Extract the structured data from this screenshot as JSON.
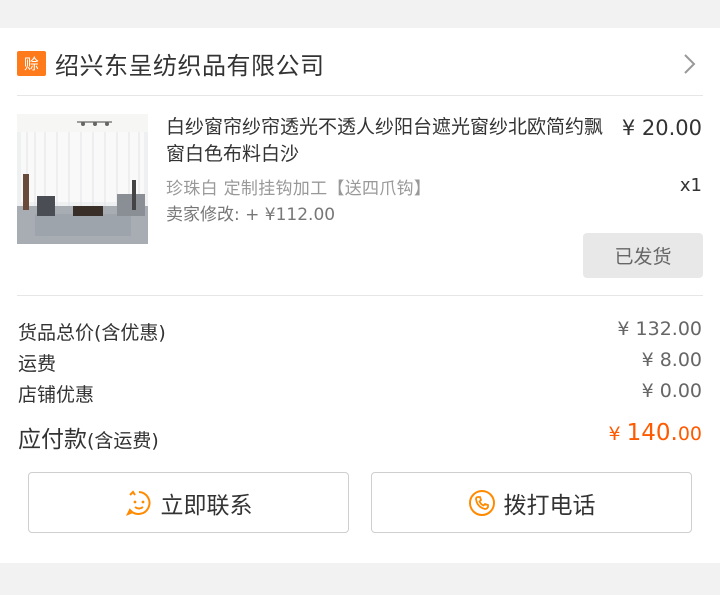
{
  "shop": {
    "badge": "赊",
    "name": "绍兴东呈纺织品有限公司"
  },
  "item": {
    "title": "白纱窗帘纱帘透光不透人纱阳台遮光窗纱北欧简约飘窗白色布料白沙",
    "price": "¥ 20.00",
    "sku": "珍珠白 定制挂钩加工【送四爪钩】",
    "quantity": "x1",
    "seller_modify": "卖家修改: + ¥112.00",
    "status_button": "已发货"
  },
  "summary": {
    "goods_total_label": "货品总价(含优惠)",
    "goods_total_value": "¥ 132.00",
    "shipping_label": "运费",
    "shipping_value": "¥ 8.00",
    "discount_label": "店铺优惠",
    "discount_value": "¥ 0.00",
    "payable_label": "应付款",
    "payable_sub": "(含运费)",
    "payable_currency": "¥ ",
    "payable_int": "140.",
    "payable_dec": "00"
  },
  "actions": {
    "contact_label": "立即联系",
    "call_label": "拨打电话"
  },
  "colors": {
    "accent": "#ff7a1a",
    "price_highlight": "#ff5a00"
  },
  "icons": [
    "chevron-right-icon",
    "chat-smile-icon",
    "phone-icon"
  ]
}
